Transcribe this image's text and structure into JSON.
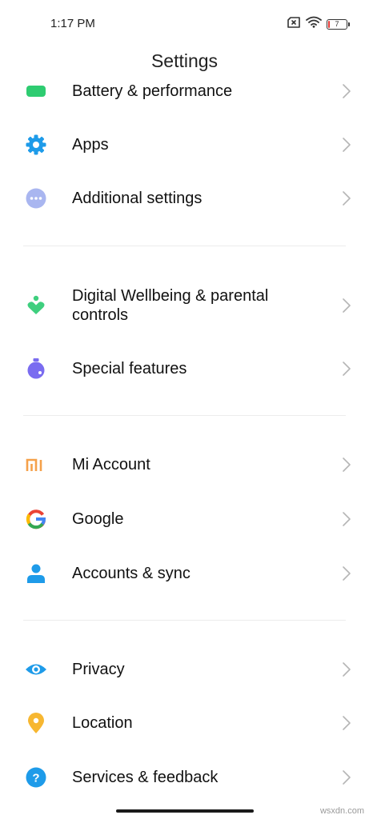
{
  "status_bar": {
    "time": "1:17 PM",
    "battery_level": "7",
    "battery_fraction": 0.07,
    "icons": [
      "sim-card-x-icon",
      "wifi-icon",
      "battery-icon"
    ]
  },
  "header": {
    "title": "Settings"
  },
  "items": [
    {
      "label": "Battery & performance",
      "icon": "battery-icon",
      "color": "#2ecc71"
    },
    {
      "label": "Apps",
      "icon": "gear-icon",
      "color": "#1e9be9"
    },
    {
      "label": "Additional settings",
      "icon": "more-dots-icon",
      "color": "#a9b6f0"
    },
    {
      "label": "Digital Wellbeing & parental controls",
      "icon": "wellbeing-heart-icon",
      "color": "#3ecf7e"
    },
    {
      "label": "Special features",
      "icon": "special-features-icon",
      "color": "#7a6cf0"
    },
    {
      "label": "Mi Account",
      "icon": "mi-logo-icon",
      "color": "#f5a14a"
    },
    {
      "label": "Google",
      "icon": "google-g-icon",
      "color": "#4285f4"
    },
    {
      "label": "Accounts & sync",
      "icon": "person-icon",
      "color": "#1e9be9"
    },
    {
      "label": "Privacy",
      "icon": "eye-icon",
      "color": "#1e9be9"
    },
    {
      "label": "Location",
      "icon": "location-pin-icon",
      "color": "#f7b731"
    },
    {
      "label": "Services & feedback",
      "icon": "help-icon",
      "color": "#1e9be9"
    }
  ],
  "watermark": "wsxdn.com"
}
